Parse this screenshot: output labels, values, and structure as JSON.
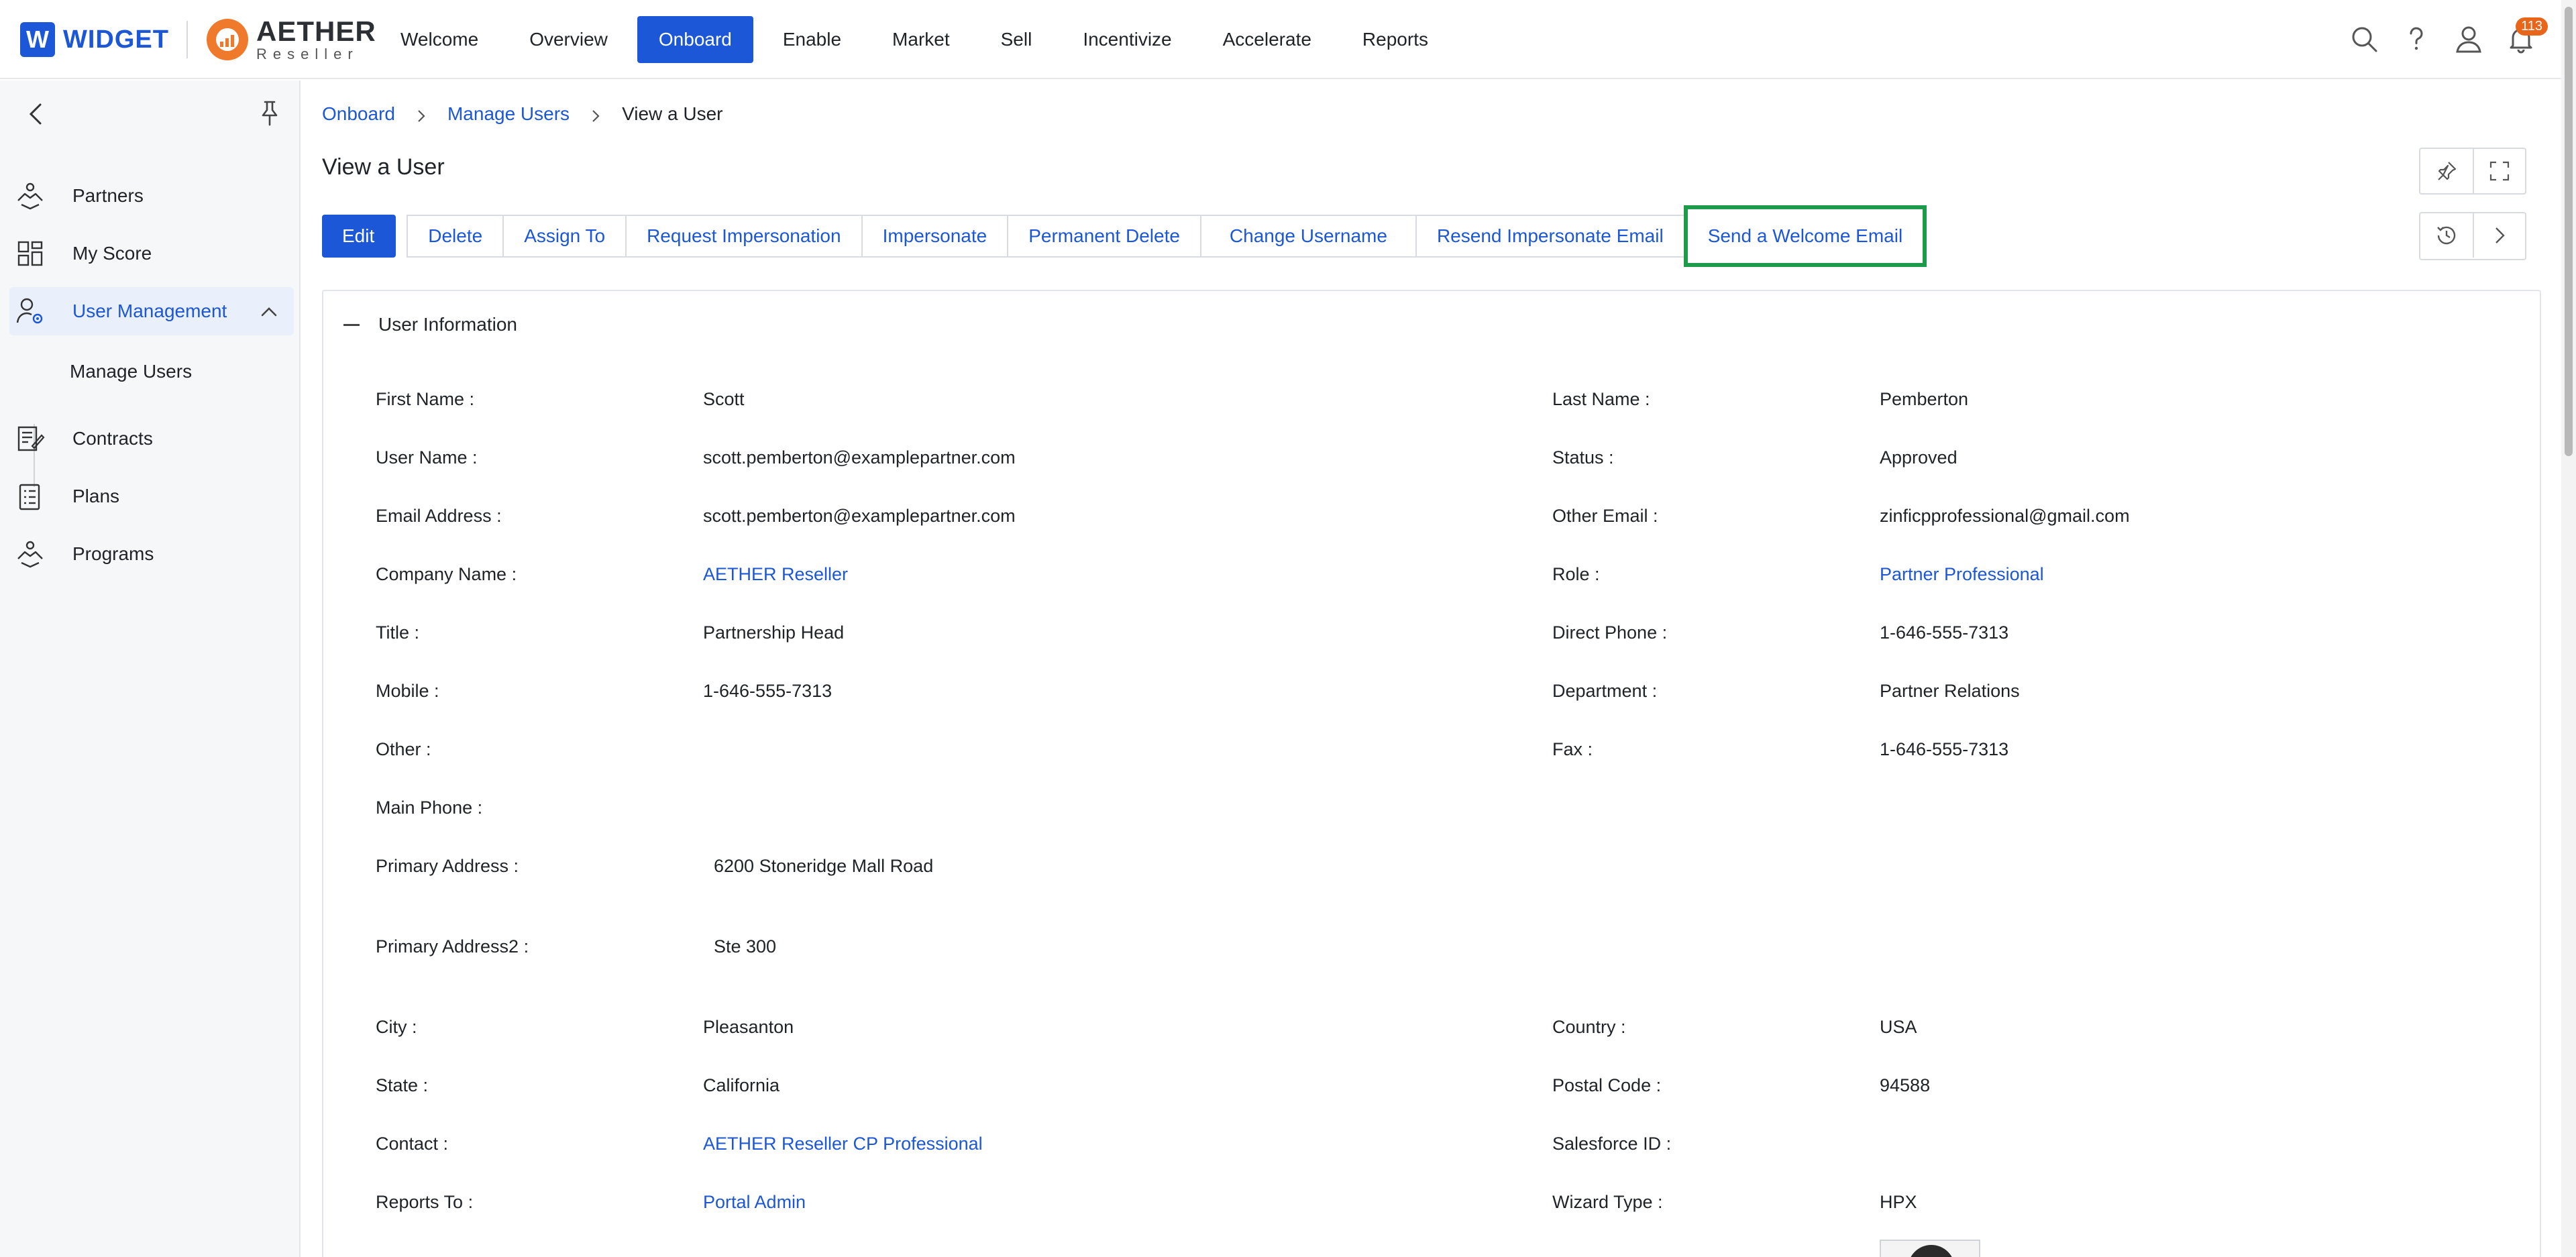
{
  "brand": {
    "widget_letter": "W",
    "widget_text": "WIDGET",
    "aether_name": "AETHER",
    "aether_sub": "Reseller"
  },
  "nav": {
    "items": [
      {
        "label": "Welcome"
      },
      {
        "label": "Overview"
      },
      {
        "label": "Onboard",
        "active": true
      },
      {
        "label": "Enable"
      },
      {
        "label": "Market"
      },
      {
        "label": "Sell"
      },
      {
        "label": "Incentivize"
      },
      {
        "label": "Accelerate"
      },
      {
        "label": "Reports"
      }
    ]
  },
  "top_icons": {
    "notification_count": "113",
    "icons": [
      "search-icon",
      "help-icon",
      "user-icon",
      "bell-icon"
    ]
  },
  "sidebar": {
    "items": [
      {
        "label": "Partners",
        "icon": "partners-icon"
      },
      {
        "label": "My Score",
        "icon": "dashboard-icon"
      },
      {
        "label": "User Management",
        "icon": "user-gear-icon",
        "active": true
      },
      {
        "label": "Contracts",
        "icon": "contract-icon"
      },
      {
        "label": "Plans",
        "icon": "checklist-icon"
      },
      {
        "label": "Programs",
        "icon": "programs-icon"
      }
    ],
    "sub_items": [
      {
        "label": "Manage Users"
      }
    ]
  },
  "breadcrumb": {
    "items": [
      "Onboard",
      "Manage Users"
    ],
    "current": "View a User"
  },
  "page": {
    "title": "View a User"
  },
  "actions": {
    "edit": "Edit",
    "delete": "Delete",
    "assign_to": "Assign To",
    "request_impersonation": "Request Impersonation",
    "impersonate": "Impersonate",
    "permanent_delete": "Permanent Delete",
    "change_username": "Change Username",
    "resend_impersonate_email": "Resend Impersonate Email",
    "send_welcome_email": "Send a Welcome Email"
  },
  "panel": {
    "title": "User Information"
  },
  "fields": {
    "first_name": {
      "label": "First Name :",
      "value": "Scott"
    },
    "last_name": {
      "label": "Last Name :",
      "value": "Pemberton"
    },
    "user_name": {
      "label": "User Name :",
      "value": "scott.pemberton@examplepartner.com"
    },
    "status": {
      "label": "Status :",
      "value": "Approved"
    },
    "email": {
      "label": "Email Address :",
      "value": "scott.pemberton@examplepartner.com"
    },
    "other_email": {
      "label": "Other Email :",
      "value": "zinficpprofessional@gmail.com"
    },
    "company": {
      "label": "Company Name :",
      "value": "AETHER Reseller"
    },
    "role": {
      "label": "Role :",
      "value": "Partner Professional"
    },
    "title": {
      "label": "Title :",
      "value": "Partnership Head"
    },
    "direct_phone": {
      "label": "Direct Phone :",
      "value": "1-646-555-7313"
    },
    "mobile": {
      "label": "Mobile :",
      "value": "1-646-555-7313"
    },
    "department": {
      "label": "Department :",
      "value": "Partner Relations"
    },
    "other": {
      "label": "Other :",
      "value": ""
    },
    "fax": {
      "label": "Fax :",
      "value": "1-646-555-7313"
    },
    "main_phone": {
      "label": "Main Phone :",
      "value": ""
    },
    "primary_address": {
      "label": "Primary Address :",
      "value": "6200 Stoneridge Mall Road"
    },
    "primary_address2": {
      "label": "Primary Address2 :",
      "value": "Ste 300"
    },
    "city": {
      "label": "City :",
      "value": "Pleasanton"
    },
    "country": {
      "label": "Country :",
      "value": "USA"
    },
    "state": {
      "label": "State :",
      "value": "California"
    },
    "postal_code": {
      "label": "Postal Code :",
      "value": "94588"
    },
    "contact": {
      "label": "Contact :",
      "value": "AETHER Reseller CP Professional"
    },
    "salesforce_id": {
      "label": "Salesforce ID :",
      "value": ""
    },
    "reports_to": {
      "label": "Reports To :",
      "value": "Portal Admin"
    },
    "wizard_type": {
      "label": "Wizard Type :",
      "value": "HPX"
    }
  },
  "colors": {
    "accent": "#1b57d6",
    "highlight": "#1e9b4a",
    "badge": "#e8651a",
    "brand_orange": "#f07a2c"
  }
}
